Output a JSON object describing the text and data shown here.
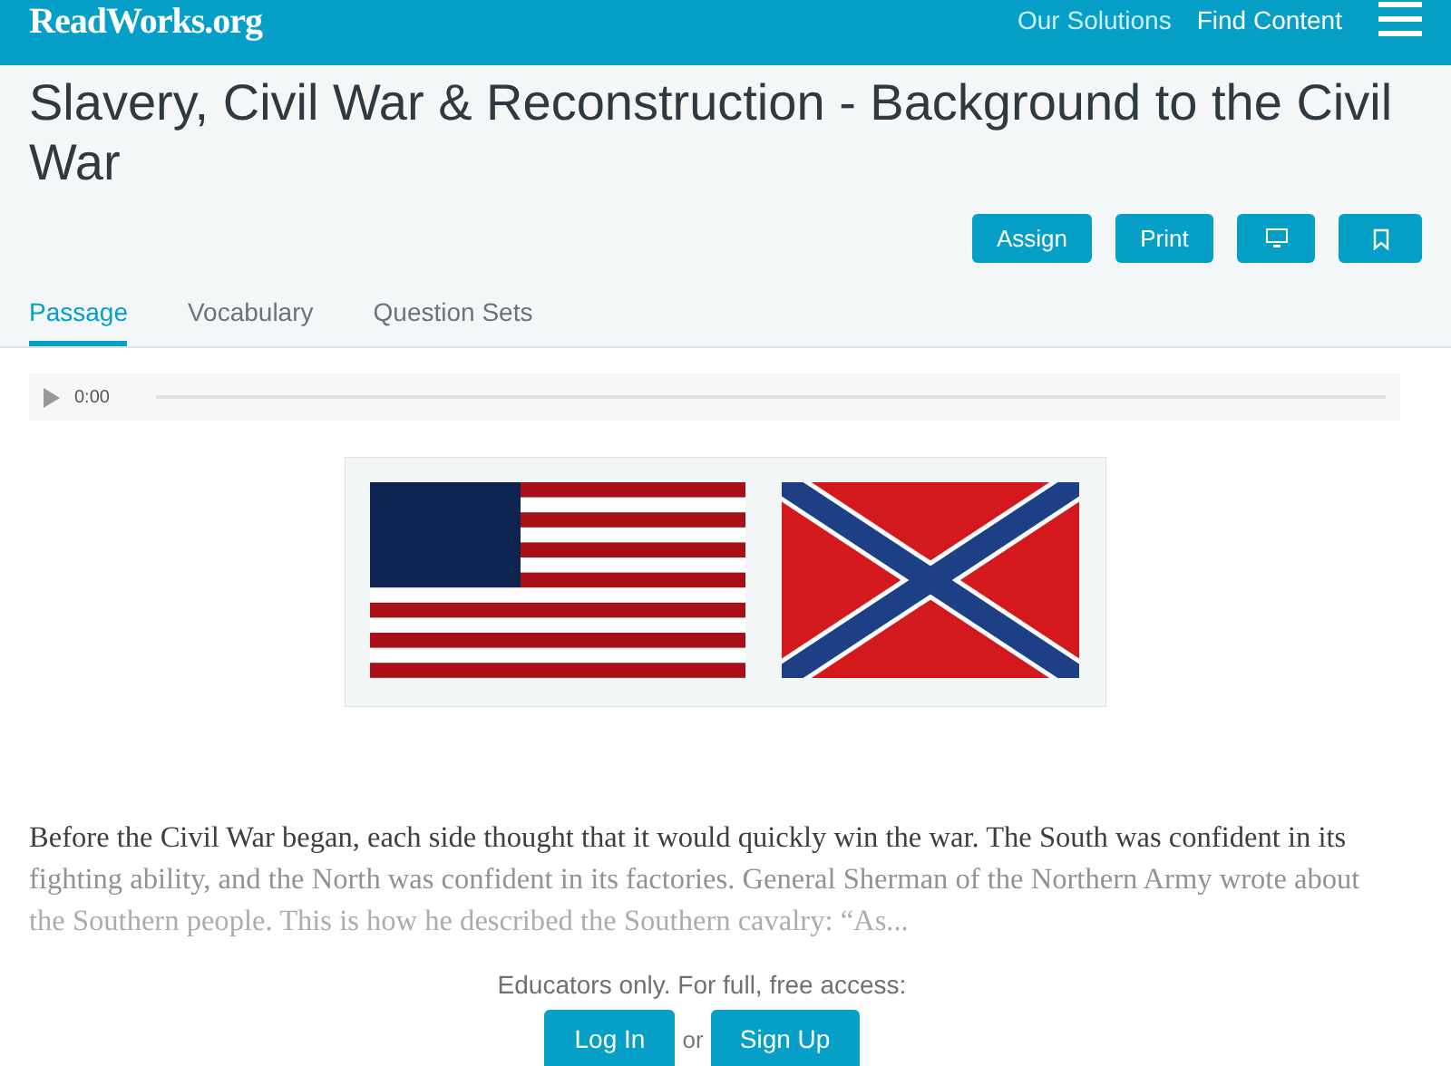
{
  "header": {
    "logo": "ReadWorks.org",
    "links": [
      "Our Solutions",
      "Find Content"
    ]
  },
  "title": "Slavery, Civil War & Reconstruction - Background to the Civil War",
  "actions": [
    {
      "kind": "text",
      "label": "Assign"
    },
    {
      "kind": "text",
      "label": "Print"
    },
    {
      "kind": "monitor"
    },
    {
      "kind": "bookmark"
    }
  ],
  "tabs": [
    {
      "label": "Passage",
      "selected": true
    },
    {
      "label": "Vocabulary",
      "selected": false
    },
    {
      "label": "Question Sets",
      "selected": false
    }
  ],
  "audio": {
    "time": "0:00"
  },
  "figure": {
    "kind": "picture"
  },
  "passage_lines": [
    "Before the Civil War began, each side thought that it would quickly win the war. The South was confident in its",
    "fighting ability, and the North was confident in its factories. General Sherman of the Northern Army wrote about",
    "the Southern people. This is how he described the Southern cavalry: “As..."
  ],
  "access": {
    "text": "Educators only. For full, free access:",
    "login": "Log In",
    "or": "or",
    "signup": "Sign Up"
  }
}
